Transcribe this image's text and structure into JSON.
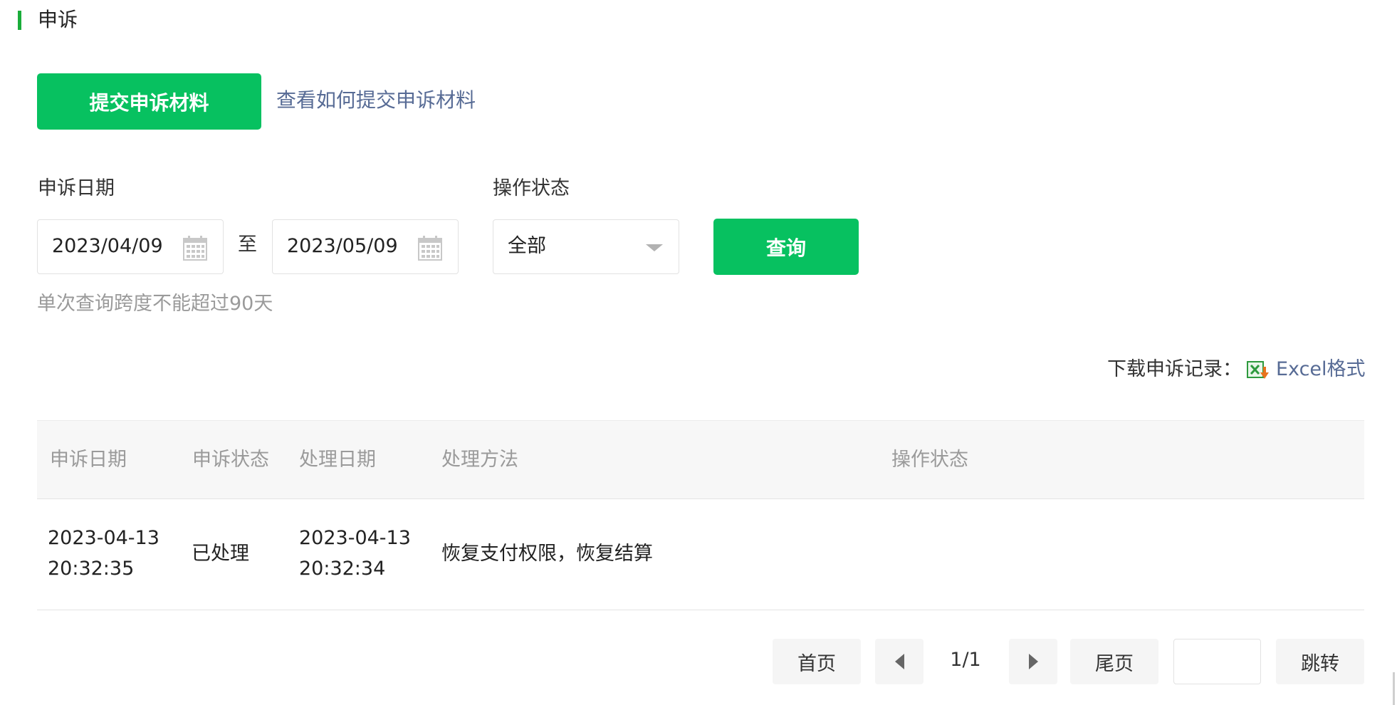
{
  "section": {
    "title": "申诉"
  },
  "actions": {
    "submit_label": "提交申诉材料",
    "howto_label": "查看如何提交申诉材料"
  },
  "filters": {
    "date_label": "申诉日期",
    "date_from": "2023/04/09",
    "separator": "至",
    "date_to": "2023/05/09",
    "status_label": "操作状态",
    "status_selected": "全部",
    "query_label": "查询",
    "hint": "单次查询跨度不能超过90天"
  },
  "download": {
    "label": "下载申诉记录：",
    "excel_label": "Excel格式",
    "icon": "excel-icon"
  },
  "table": {
    "headers": [
      "申诉日期",
      "申诉状态",
      "处理日期",
      "处理方法",
      "操作状态"
    ],
    "rows": [
      {
        "appeal_date": "2023-04-13",
        "appeal_time": "20:32:35",
        "status": "已处理",
        "handle_date": "2023-04-13",
        "handle_time": "20:32:34",
        "method": "恢复支付权限，恢复结算",
        "op_status": ""
      }
    ]
  },
  "pagination": {
    "first": "首页",
    "info": "1/1",
    "last": "尾页",
    "go": "跳转",
    "input_value": ""
  },
  "colors": {
    "accent": "#07c160",
    "link": "#576b95",
    "muted": "#9a9a9a"
  }
}
